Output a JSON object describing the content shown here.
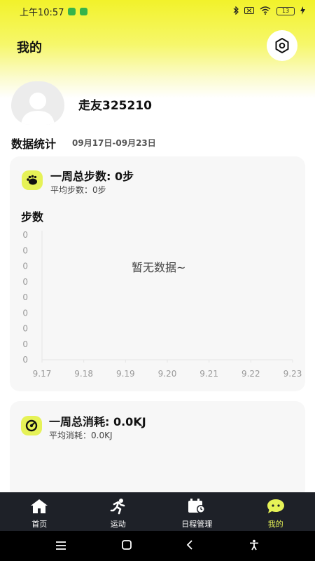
{
  "status_bar": {
    "time": "上午10:57",
    "battery": "13"
  },
  "header": {
    "title": "我的"
  },
  "profile": {
    "username": "走友325210"
  },
  "stats": {
    "title": "数据统计",
    "range": "09月17日-09月23日"
  },
  "steps_card": {
    "title": "一周总步数: 0步",
    "average": "平均步数：0步",
    "chart_label": "步数",
    "empty_text": "暂无数据~"
  },
  "energy_card": {
    "title": "一周总消耗: 0.0KJ",
    "average": "平均消耗：0.0KJ"
  },
  "chart_data": {
    "type": "line",
    "title": "步数",
    "categories": [
      "9.17",
      "9.18",
      "9.19",
      "9.20",
      "9.21",
      "9.22",
      "9.23"
    ],
    "y_ticks": [
      "0",
      "0",
      "0",
      "0",
      "0",
      "0",
      "0",
      "0",
      "0"
    ],
    "series": [],
    "empty_message": "暂无数据~"
  },
  "tabs": [
    {
      "label": "首页",
      "icon": "home-icon",
      "active": false
    },
    {
      "label": "运动",
      "icon": "running-icon",
      "active": false
    },
    {
      "label": "日程管理",
      "icon": "schedule-icon",
      "active": false
    },
    {
      "label": "我的",
      "icon": "profile-chat-icon",
      "active": true
    }
  ],
  "colors": {
    "accent": "#e6f257",
    "tabbar_bg": "#1e2128",
    "hero_top": "#f2f22a"
  }
}
